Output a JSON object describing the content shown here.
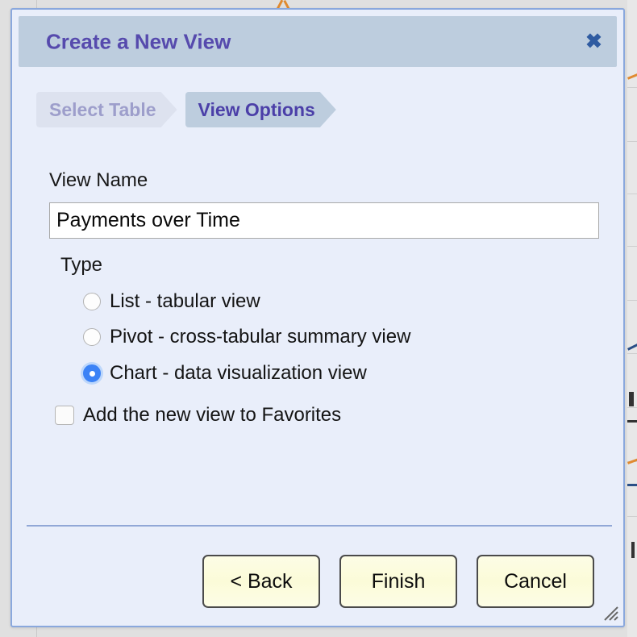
{
  "dialog": {
    "title": "Create a New View",
    "close_icon": "close-icon",
    "close_glyph": "✖",
    "accent_color": "#564aad",
    "header_bg": "#bdcdde",
    "body_bg": "#e9eefa",
    "border_color": "#8aa8dd"
  },
  "wizard_tabs": [
    {
      "label": "Select Table",
      "state": "inactive"
    },
    {
      "label": "View Options",
      "state": "active"
    }
  ],
  "form": {
    "view_name_label": "View Name",
    "view_name_value": "Payments over Time",
    "view_name_placeholder": "",
    "type_label": "Type",
    "type_options": [
      {
        "label": "List - tabular view",
        "selected": false
      },
      {
        "label": "Pivot - cross-tabular summary view",
        "selected": false
      },
      {
        "label": "Chart - data visualization view",
        "selected": true
      }
    ],
    "favorites_label": "Add the new view to Favorites",
    "favorites_checked": false,
    "selected_radio_color": "#3b82f6"
  },
  "footer": {
    "back_label": "< Back",
    "finish_label": "Finish",
    "cancel_label": "Cancel",
    "button_bg": "#fdfde6",
    "separator_color": "#91a7d6"
  },
  "resize_grip": {
    "icon": "resize-grip-icon"
  }
}
